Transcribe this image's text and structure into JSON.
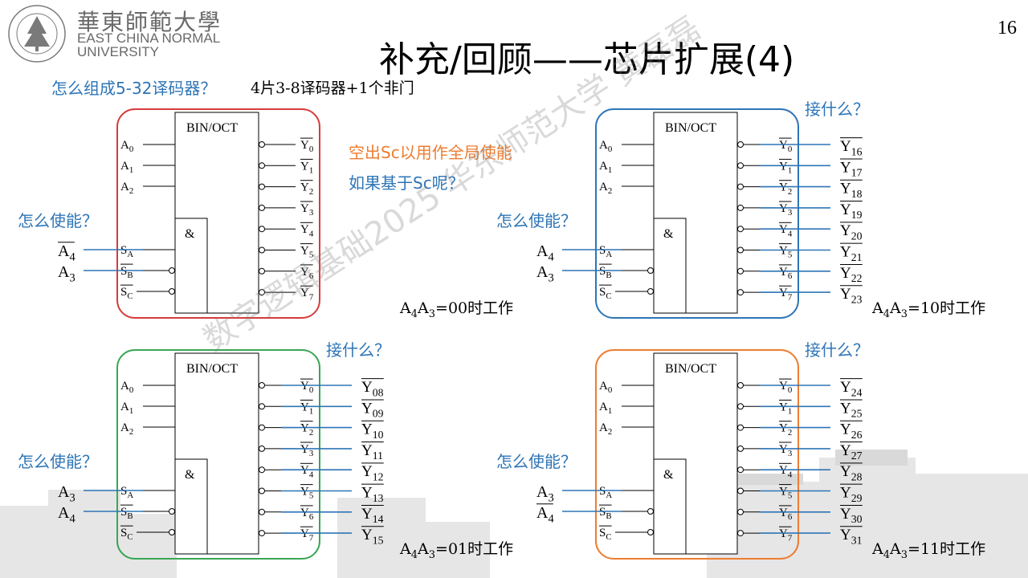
{
  "header": {
    "logo_cn": "華東師範大學",
    "logo_en_line1": "EAST CHINA NORMAL",
    "logo_en_line2": "UNIVERSITY",
    "logo_seal_text": "EAST CHINA NORMAL UNIVERSITY",
    "page_number": "16",
    "title": "补充/回顾——芯片扩展(4)"
  },
  "intro": {
    "question": "怎么组成5-32译码器？",
    "answer": "4片3-8译码器+1个非门"
  },
  "notes": {
    "spare_sc": "空出Sc以用作全局使能",
    "based_on_sc": "如果基于Sc呢？"
  },
  "chip": {
    "label": "BIN/OCT",
    "and_label": "&",
    "addr_inputs": [
      "A0",
      "A1",
      "A2"
    ],
    "enable_inputs": [
      "SA",
      "SB",
      "SC"
    ],
    "outputs": [
      "Y0",
      "Y1",
      "Y2",
      "Y3",
      "Y4",
      "Y5",
      "Y6",
      "Y7"
    ]
  },
  "panels": [
    {
      "id": "top-left",
      "border_color": "#d63c3c",
      "enable_question": "怎么使能？",
      "output_question": "",
      "enable_signals": [
        "A4",
        "A3"
      ],
      "enable_signals_overbar": [
        true,
        false
      ],
      "output_labels": [],
      "condition": "A4A3=00时工作"
    },
    {
      "id": "top-right",
      "border_color": "#2e75b6",
      "enable_question": "怎么使能？",
      "output_question": "接什么？",
      "enable_signals": [
        "A4",
        "A3"
      ],
      "enable_signals_overbar": [
        false,
        false
      ],
      "output_labels": [
        "Y16",
        "Y17",
        "Y18",
        "Y19",
        "Y20",
        "Y21",
        "Y22",
        "Y23"
      ],
      "condition": "A4A3=10时工作"
    },
    {
      "id": "bottom-left",
      "border_color": "#3aa655",
      "enable_question": "怎么使能？",
      "output_question": "接什么？",
      "enable_signals": [
        "A3",
        "A4"
      ],
      "enable_signals_overbar": [
        false,
        false
      ],
      "output_labels": [
        "Y08",
        "Y09",
        "Y10",
        "Y11",
        "Y12",
        "Y13",
        "Y14",
        "Y15"
      ],
      "condition": "A4A3=01时工作"
    },
    {
      "id": "bottom-right",
      "border_color": "#ed7d31",
      "enable_question": "怎么使能？",
      "output_question": "接什么？",
      "enable_signals": [
        "A3",
        "A4"
      ],
      "enable_signals_overbar": [
        false,
        true
      ],
      "output_labels": [
        "Y24",
        "Y25",
        "Y26",
        "Y27",
        "Y28",
        "Y29",
        "Y30",
        "Y31"
      ],
      "condition": "A4A3=11时工作"
    }
  ],
  "watermark": "数字逻辑基础2025 华东师范大学 黄磊磊",
  "colors": {
    "wire_blue": "#2e75b6",
    "text_blue": "#2e75b6",
    "orange": "#ed7d31"
  }
}
